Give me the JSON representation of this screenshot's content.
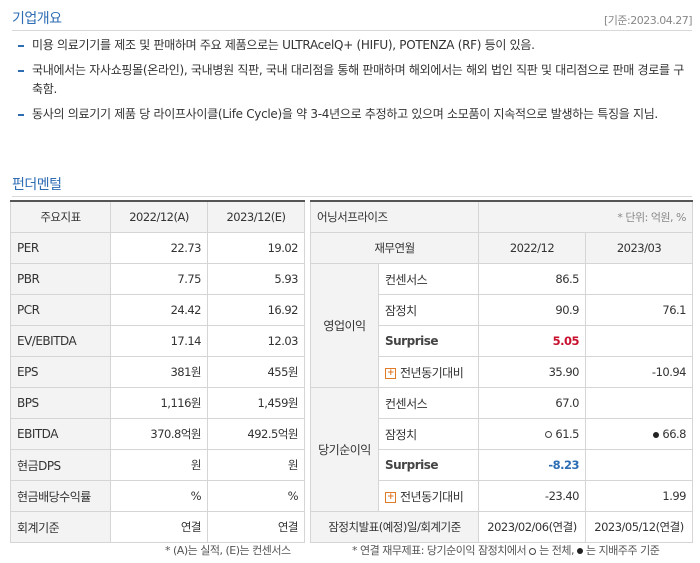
{
  "overview": {
    "title": "기업개요",
    "date": "[기준:2023.04.27]",
    "bullets": [
      "미용 의료기기를 제조 및 판매하며 주요 제품으로는 ULTRAcelQ+ (HIFU), POTENZA (RF) 등이 있음.",
      "국내에서는 자사쇼핑몰(온라인), 국내병원 직판, 국내 대리점을 통해 판매하며 해외에서는 해외 법인 직판 및 대리점으로 판매 경로를 구축함.",
      "동사의 의료기기 제품 당 라이프사이클(Life Cycle)을 약 3-4년으로 추정하고 있으며 소모품이 지속적으로 발생하는 특징을 지님."
    ]
  },
  "fundamental": {
    "title": "펀더멘털",
    "headers": [
      "주요지표",
      "2022/12(A)",
      "2023/12(E)"
    ],
    "rows": [
      {
        "label": "PER",
        "a": "22.73",
        "e": "19.02"
      },
      {
        "label": "PBR",
        "a": "7.75",
        "e": "5.93"
      },
      {
        "label": "PCR",
        "a": "24.42",
        "e": "16.92"
      },
      {
        "label": "EV/EBITDA",
        "a": "17.14",
        "e": "12.03"
      },
      {
        "label": "EPS",
        "a": "381원",
        "e": "455원"
      },
      {
        "label": "BPS",
        "a": "1,116원",
        "e": "1,459원"
      },
      {
        "label": "EBITDA",
        "a": "370.8억원",
        "e": "492.5억원"
      },
      {
        "label": "현금DPS",
        "a": "원",
        "e": "원"
      },
      {
        "label": "현금배당수익률",
        "a": "%",
        "e": "%"
      },
      {
        "label": "회계기준",
        "a": "연결",
        "e": "연결"
      }
    ],
    "note": "* (A)는 실적, (E)는 컨센서스"
  },
  "surprise": {
    "title": "어닝서프라이즈",
    "unit": "* 단위: 억원, %",
    "headers": [
      "재무연월",
      "2022/12",
      "2023/03"
    ],
    "op_label": "영업이익",
    "ni_label": "당기순이익",
    "op": {
      "consensus": {
        "label": "컨센서스",
        "v1": "86.5",
        "v2": ""
      },
      "prelim": {
        "label": "잠정치",
        "v1": "90.9",
        "v2": "76.1"
      },
      "surprise": {
        "label": "Surprise",
        "v1": "5.05",
        "v2": ""
      },
      "yoy": {
        "label": "전년동기대비",
        "v1": "35.90",
        "v2": "-10.94"
      }
    },
    "ni": {
      "consensus": {
        "label": "컨센서스",
        "v1": "67.0",
        "v2": ""
      },
      "prelim": {
        "label": "잠정치",
        "v1": "61.5",
        "v2": "66.8"
      },
      "surprise": {
        "label": "Surprise",
        "v1": "-8.23",
        "v2": ""
      },
      "yoy": {
        "label": "전년동기대비",
        "v1": "-23.40",
        "v2": "1.99"
      }
    },
    "announce": {
      "label": "잠정치발표(예정)일/회계기준",
      "v1": "2023/02/06(연결)",
      "v2": "2023/05/12(연결)"
    },
    "note_pre": "* 연결 재무제표: 당기순이익 잠정치에서",
    "note_mid": "는 전체,",
    "note_post": "는 지배주주 기준"
  },
  "colors": {
    "accent": "#2e6db4",
    "positive": "#c8102e",
    "negative": "#2e6db4",
    "plus": "#e07b2a"
  }
}
